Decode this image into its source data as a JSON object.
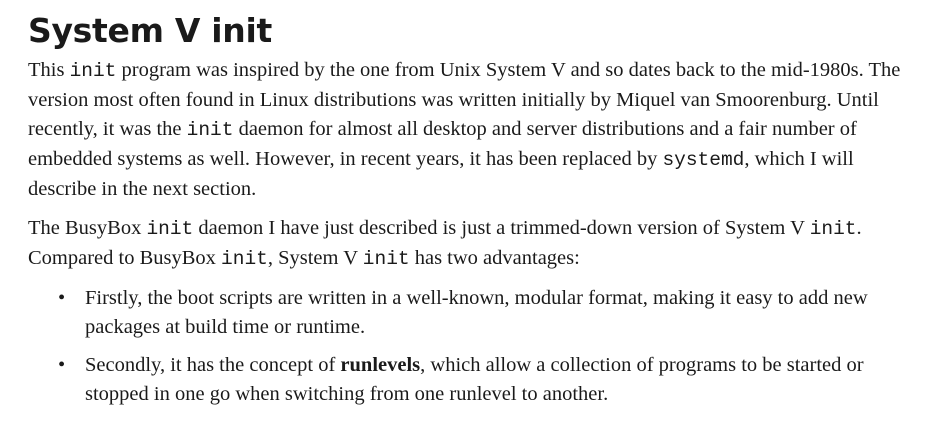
{
  "heading": "System V init",
  "p1": {
    "t1": "This ",
    "c1": "init",
    "t2": " program was inspired by the one from Unix System V and so dates back to the mid-1980s. The version most often found in Linux distributions was written initially by Miquel van Smoorenburg. Until recently, it was the ",
    "c2": "init",
    "t3": " daemon for almost all desktop and server distributions and a fair number of embedded systems as well. However, in recent years, it has been replaced by ",
    "c3": "systemd",
    "t4": ", which I will describe in the next section."
  },
  "p2": {
    "t1": "The BusyBox ",
    "c1": "init",
    "t2": " daemon I have just described is just a trimmed-down version of System V ",
    "c2": "init",
    "t3": ". Compared to BusyBox ",
    "c3": "init",
    "t4": ", System V ",
    "c4": "init",
    "t5": " has two advantages:"
  },
  "bullet_symbol": "•",
  "bullets": [
    {
      "text": "Firstly, the boot scripts are written in a well-known, modular format, making it easy to add new packages at build time or runtime."
    },
    {
      "pre": "Secondly, it has the concept of ",
      "bold": "runlevels",
      "post": ", which allow a collection of programs to be started or stopped in one go when switching from one runlevel to another."
    }
  ]
}
